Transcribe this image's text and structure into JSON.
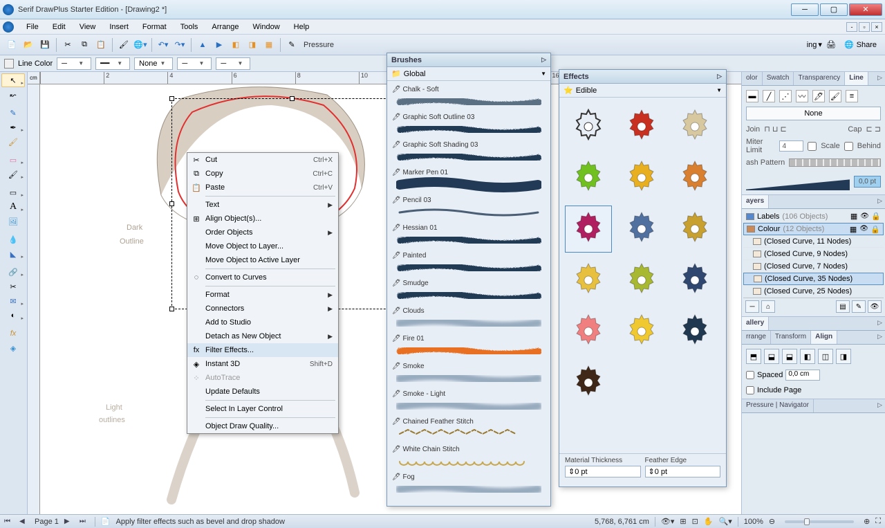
{
  "app": {
    "title": "Serif DrawPlus Starter Edition - [Drawing2 *]"
  },
  "menu": [
    "File",
    "Edit",
    "View",
    "Insert",
    "Format",
    "Tools",
    "Arrange",
    "Window",
    "Help"
  ],
  "toolbar": {
    "pressure": "Pressure",
    "share": "Share",
    "print": "ing"
  },
  "linebar": {
    "linecolor": "Line Color",
    "none": "None"
  },
  "ruler_unit": "cm",
  "context_menu": [
    {
      "t": "item",
      "icon": "✂",
      "label": "Cut",
      "shortcut": "Ctrl+X"
    },
    {
      "t": "item",
      "icon": "⧉",
      "label": "Copy",
      "shortcut": "Ctrl+C"
    },
    {
      "t": "item",
      "icon": "📋",
      "label": "Paste",
      "shortcut": "Ctrl+V"
    },
    {
      "t": "sep"
    },
    {
      "t": "sub",
      "icon": "",
      "label": "Text"
    },
    {
      "t": "item",
      "icon": "⊞",
      "label": "Align Object(s)..."
    },
    {
      "t": "sub",
      "icon": "",
      "label": "Order Objects"
    },
    {
      "t": "item",
      "icon": "",
      "label": "Move Object to Layer..."
    },
    {
      "t": "item",
      "icon": "",
      "label": "Move Object to Active Layer"
    },
    {
      "t": "sep"
    },
    {
      "t": "item",
      "icon": "◌",
      "label": "Convert to Curves"
    },
    {
      "t": "sep"
    },
    {
      "t": "sub",
      "icon": "",
      "label": "Format"
    },
    {
      "t": "sub",
      "icon": "",
      "label": "Connectors"
    },
    {
      "t": "item",
      "icon": "",
      "label": "Add to Studio"
    },
    {
      "t": "sub",
      "icon": "",
      "label": "Detach as New Object"
    },
    {
      "t": "item",
      "icon": "fx",
      "label": "Filter Effects...",
      "hl": true
    },
    {
      "t": "item",
      "icon": "◈",
      "label": "Instant 3D",
      "shortcut": "Shift+D"
    },
    {
      "t": "item",
      "icon": "⁘",
      "label": "AutoTrace",
      "dis": true
    },
    {
      "t": "item",
      "icon": "",
      "label": "Update Defaults"
    },
    {
      "t": "sep"
    },
    {
      "t": "item",
      "icon": "",
      "label": "Select In Layer Control"
    },
    {
      "t": "sep"
    },
    {
      "t": "item",
      "icon": "",
      "label": "Object Draw Quality..."
    }
  ],
  "brushes": {
    "title": "Brushes",
    "category": "Global",
    "items": [
      {
        "name": "Chalk - Soft",
        "style": "chalk"
      },
      {
        "name": "Graphic Soft Outline 03",
        "style": "softline"
      },
      {
        "name": "Graphic Soft Shading 03",
        "style": "shade"
      },
      {
        "name": "Marker Pen 01",
        "style": "marker"
      },
      {
        "name": "Pencil 03",
        "style": "pencil"
      },
      {
        "name": "Hessian 01",
        "style": "hessian"
      },
      {
        "name": "Painted",
        "style": "paint"
      },
      {
        "name": "Smudge",
        "style": "smudge"
      },
      {
        "name": "Clouds",
        "style": "clouds"
      },
      {
        "name": "Fire 01",
        "style": "fire"
      },
      {
        "name": "Smoke",
        "style": "smoke"
      },
      {
        "name": "Smoke - Light",
        "style": "smokel"
      },
      {
        "name": "Chained Feather Stitch",
        "style": "chain"
      },
      {
        "name": "White Chain Stitch",
        "style": "ochain"
      },
      {
        "name": "Fog",
        "style": "fog"
      }
    ]
  },
  "effects": {
    "title": "Effects",
    "category": "Edible",
    "items": [
      {
        "fill": "none",
        "stroke": "#333"
      },
      {
        "fill": "#c83020"
      },
      {
        "fill": "#d8c8a0"
      },
      {
        "fill": "#70c020"
      },
      {
        "fill": "#e8b020"
      },
      {
        "fill": "#d88030"
      },
      {
        "fill": "#b02060",
        "sel": true
      },
      {
        "fill": "#5070a0"
      },
      {
        "fill": "#c8a030"
      },
      {
        "fill": "#e8c040"
      },
      {
        "fill": "#a8b830"
      },
      {
        "fill": "#304870"
      },
      {
        "fill": "#f08080"
      },
      {
        "fill": "#f0c830"
      },
      {
        "fill": "#203850"
      },
      {
        "fill": "#402818"
      }
    ],
    "mat_thick_label": "Material Thickness",
    "mat_thick": "0 pt",
    "feather_label": "Feather Edge",
    "feather": "0 pt"
  },
  "right": {
    "color_tabs": [
      "olor",
      "Swatch",
      "Transparency",
      "Line"
    ],
    "line_none": "None",
    "join_label": "Join",
    "cap_label": "Cap",
    "miter_label": "Miter Limit",
    "miter_val": "4",
    "scale_label": "Scale",
    "behind_label": "Behind",
    "dash_label": "ash Pattern",
    "pt_val": "0,0 pt",
    "layers_tab": "ayers",
    "layers": [
      {
        "name": "Labels",
        "count": "(106 Objects)",
        "color": "#58c",
        "sel": false
      },
      {
        "name": "Colour",
        "count": "(12 Objects)",
        "color": "#c85",
        "sel": true
      }
    ],
    "layer_items": [
      "(Closed Curve, 11 Nodes)",
      "(Closed Curve, 9 Nodes)",
      "(Closed Curve, 7 Nodes)",
      "(Closed Curve, 35 Nodes)",
      "(Closed Curve, 25 Nodes)"
    ],
    "layer_item_sel": 3,
    "gallery_tab": "allery",
    "tr_tabs": [
      "rrange",
      "Transform",
      "Align"
    ],
    "spaced_label": "Spaced",
    "spaced_val": "0,0 cm",
    "include_page": "Include Page",
    "pn_tabs": "Pressure | Navigator"
  },
  "status": {
    "page": "Page 1",
    "hint": "Apply filter effects such as bevel and drop shadow",
    "coords": "5,768, 6,761 cm",
    "zoom": "100%"
  },
  "sketch_notes": {
    "dark": "Dark\nOutline",
    "light": "Light\noutlines"
  }
}
